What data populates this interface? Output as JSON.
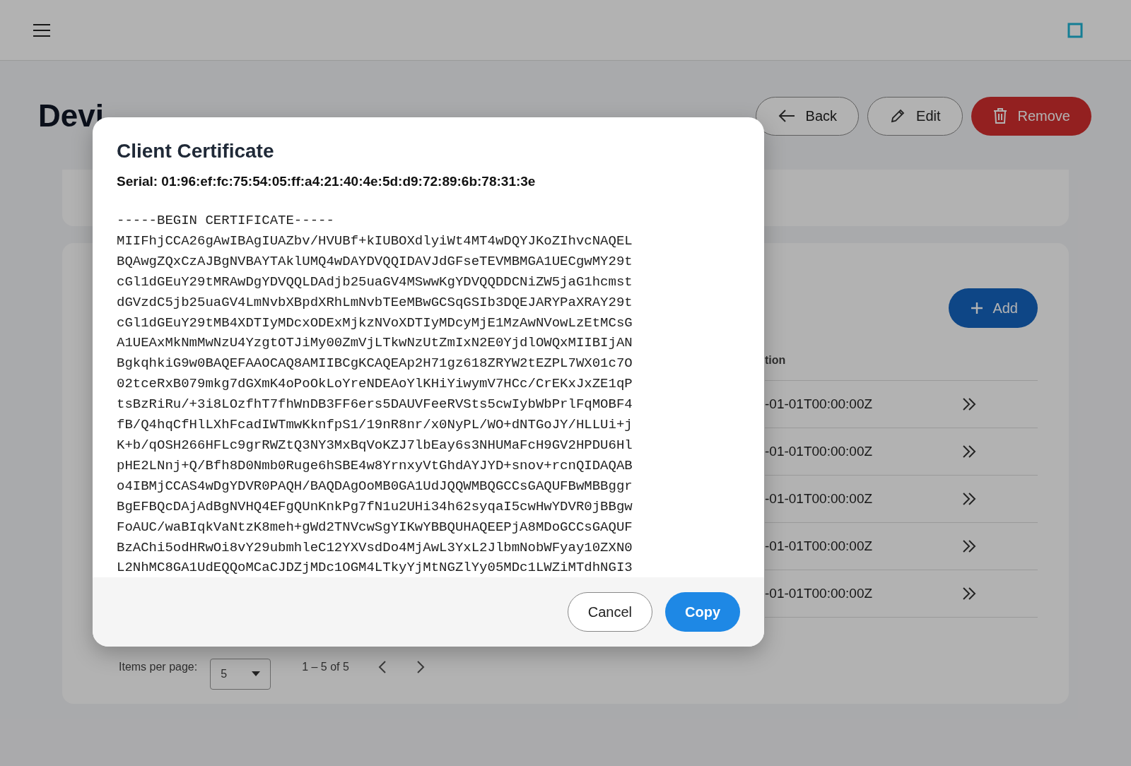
{
  "page": {
    "title": "Devi",
    "actions": [
      {
        "label": "Back",
        "kind": "back"
      },
      {
        "label": "Edit",
        "kind": "edit"
      },
      {
        "label": "Remove",
        "kind": "remove"
      }
    ]
  },
  "table": {
    "add_label": "Add",
    "column_header": "tion",
    "rows": [
      {
        "cell": "-01-01T00:00:00Z"
      },
      {
        "cell": "-01-01T00:00:00Z"
      },
      {
        "cell": "-01-01T00:00:00Z"
      },
      {
        "cell": "-01-01T00:00:00Z"
      },
      {
        "cell": "-01-01T00:00:00Z"
      }
    ],
    "paginator": {
      "label": "Items per page:",
      "page_size": "5",
      "range": "1 – 5 of 5"
    }
  },
  "dialog": {
    "title": "Client Certificate",
    "serial": "Serial: 01:96:ef:fc:75:54:05:ff:a4:21:40:4e:5d:d9:72:89:6b:78:31:3e",
    "certificate_lines": [
      "-----BEGIN CERTIFICATE-----",
      "MIIFhjCCA26gAwIBAgIUAZbv/HVUBf+kIUBOXdlyiWt4MT4wDQYJKoZIhvcNAQEL",
      "BQAwgZQxCzAJBgNVBAYTAklUMQ4wDAYDVQQIDAVJdGFseTEVMBMGA1UECgwMY29t",
      "cGl1dGEuY29tMRAwDgYDVQQLDAdjb25uaGV4MSwwKgYDVQQDDCNiZW5jaG1hcmst",
      "dGVzdC5jb25uaGV4LmNvbXBpdXRhLmNvbTEeMBwGCSqGSIb3DQEJARYPaXRAY29t",
      "cGl1dGEuY29tMB4XDTIyMDcxODExMjkzNVoXDTIyMDcyMjE1MzAwNVowLzEtMCsG",
      "A1UEAxMkNmMwNzU4YzgtOTJiMy00ZmVjLTkwNzUtZmIxN2E0YjdlOWQxMIIBIjAN",
      "BgkqhkiG9w0BAQEFAAOCAQ8AMIIBCgKCAQEAp2H71gz618ZRYW2tEZPL7WX01c7O",
      "02tceRxB079mkg7dGXmK4oPoOkLoYreNDEAoYlKHiYiwymV7HCc/CrEKxJxZE1qP",
      "tsBzRiRu/+3i8LOzfhT7fhWnDB3FF6ers5DAUVFeeRVSts5cwIybWbPrlFqMOBF4",
      "fB/Q4hqCfHlLXhFcadIWTmwKknfpS1/19nR8nr/x0NyPL/WO+dNTGoJY/HLLUi+j",
      "K+b/qOSH266HFLc9grRWZtQ3NY3MxBqVoKZJ7lbEay6s3NHUMaFcH9GV2HPDU6Hl",
      "pHE2LNnj+Q/Bfh8D0Nmb0Ruge6hSBE4w8YrnxyVtGhdAYJYD+snov+rcnQIDAQAB",
      "o4IBMjCCAS4wDgYDVR0PAQH/BAQDAgOoMB0GA1UdJQQWMBQGCCsGAQUFBwMBBggr",
      "BgEFBQcDAjAdBgNVHQ4EFgQUnKnkPg7fN1u2UHi34h62syqaI5cwHwYDVR0jBBgw",
      "FoAUC/waBIqkVaNtzK8meh+gWd2TNVcwSgYIKwYBBQUHAQEEPjA8MDoGCCsGAQUF",
      "BzAChi5odHRwOi8vY29ubmhleC12YXVsdDo4MjAwL3YxL2JlbmNobWFyay10ZXN0",
      "L2NhMC8GA1UdEQQoMCaCJDZjMDc1OGM4LTkyYjMtNGZlYy05MDc1LWZiMTdhNGI3"
    ],
    "buttons": [
      {
        "label": "Cancel",
        "kind": "secondary"
      },
      {
        "label": "Copy",
        "kind": "primary"
      }
    ]
  }
}
